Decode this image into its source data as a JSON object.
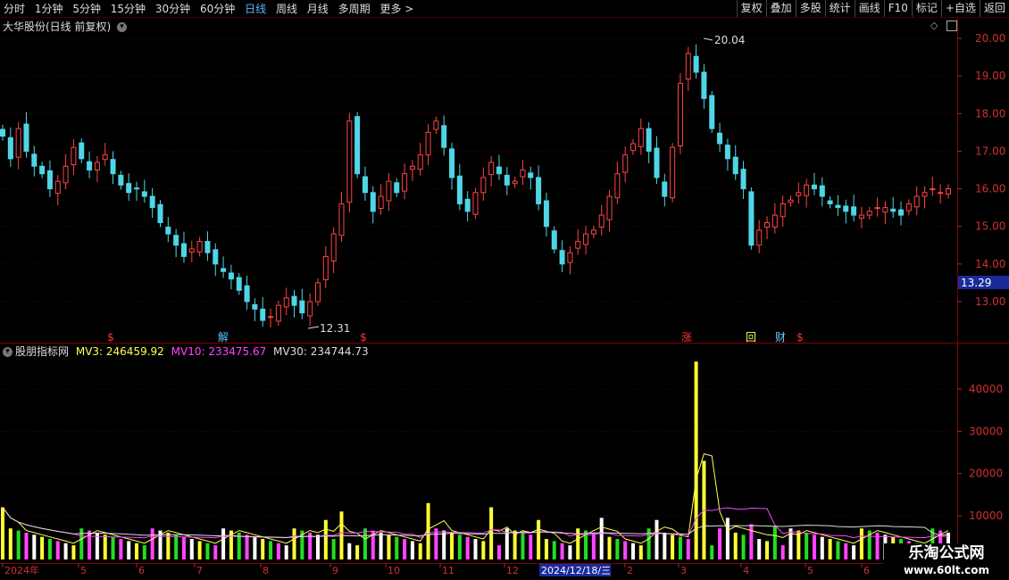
{
  "toolbar": {
    "periods": [
      "分时",
      "1分钟",
      "5分钟",
      "15分钟",
      "30分钟",
      "60分钟",
      "日线",
      "周线",
      "月线",
      "多周期",
      "更多 >"
    ],
    "active_period": "日线",
    "buttons": [
      "复权",
      "叠加",
      "多股",
      "统计",
      "画线",
      "F10",
      "标记",
      "+自选",
      "返回"
    ]
  },
  "price_panel": {
    "title": "大华股份(日线 前复权)",
    "high_label": "20.04",
    "low_label": "12.31",
    "current_price": "13.29",
    "markers": [
      {
        "text": "$",
        "color": "#ff3333"
      },
      {
        "text": "解",
        "color": "#55ccff"
      },
      {
        "text": "$",
        "color": "#ff3333"
      },
      {
        "text": "涨",
        "color": "#ff3333"
      },
      {
        "text": "回",
        "color": "#ffff66"
      },
      {
        "text": "财",
        "color": "#66ccff"
      },
      {
        "text": "$",
        "color": "#ff3333"
      }
    ]
  },
  "volume_panel": {
    "title": "股朋指标网",
    "mv3_label": "MV3: 246459.92",
    "mv10_label": "MV10: 233475.67",
    "mv30_label": "MV30: 234744.73"
  },
  "chart_data": [
    {
      "type": "candlestick",
      "title": "大华股份(日线 前复权)",
      "ylim": [
        12.0,
        20.5
      ],
      "y_ticks": [
        "20.00",
        "19.00",
        "18.00",
        "17.00",
        "16.00",
        "15.00",
        "14.00",
        "13.00"
      ],
      "close_path": [
        17.4,
        16.8,
        17.6,
        17.0,
        16.6,
        16.4,
        16.0,
        16.2,
        16.6,
        17.1,
        16.8,
        16.5,
        16.7,
        16.9,
        16.4,
        16.1,
        15.9,
        16.0,
        15.8,
        15.5,
        15.1,
        14.8,
        14.5,
        14.2,
        14.4,
        14.6,
        14.3,
        14.0,
        13.8,
        13.6,
        13.3,
        13.0,
        12.8,
        12.5,
        12.6,
        12.9,
        13.1,
        12.9,
        12.7,
        13.0,
        13.5,
        14.2,
        14.8,
        15.6,
        17.8,
        16.4,
        15.9,
        15.4,
        15.8,
        16.2,
        15.9,
        16.4,
        16.6,
        16.9,
        17.5,
        17.8,
        17.1,
        16.3,
        15.6,
        15.4,
        15.9,
        16.3,
        16.7,
        16.4,
        16.1,
        16.2,
        16.5,
        16.3,
        15.6,
        15.0,
        14.4,
        14.0,
        14.3,
        14.6,
        14.8,
        14.9,
        15.3,
        15.8,
        16.4,
        16.9,
        17.2,
        17.6,
        17.0,
        16.3,
        15.8,
        17.1,
        18.8,
        19.6,
        19.1,
        18.4,
        17.6,
        17.2,
        16.8,
        16.4,
        16.0,
        14.5,
        14.9,
        15.1,
        15.3,
        15.6,
        15.7,
        15.9,
        16.1,
        16.0,
        15.8,
        15.6,
        15.5,
        15.4,
        15.3,
        15.3,
        15.4,
        15.5,
        15.5,
        15.4,
        15.3,
        15.6,
        15.8,
        15.9,
        16.0,
        15.9,
        16.0
      ],
      "annotations": [
        "20.04",
        "12.31",
        "13.29"
      ]
    },
    {
      "type": "bar",
      "title": "股朋指标网",
      "ylim": [
        0,
        48000
      ],
      "y_ticks": [
        "40000",
        "30000",
        "20000",
        "10000"
      ],
      "x_labels": [
        "2024年",
        "5",
        "6",
        "7",
        "8",
        "9",
        "10",
        "11",
        "12",
        "2024/12/18/三",
        "2",
        "3",
        "4",
        "5",
        "6"
      ],
      "series": [
        {
          "name": "MV3",
          "value": 246459.92,
          "color": "#ffff55"
        },
        {
          "name": "MV10",
          "value": 233475.67,
          "color": "#ff44ff"
        },
        {
          "name": "MV30",
          "value": 234744.73,
          "color": "#dddddd"
        }
      ]
    }
  ],
  "watermark": {
    "line1": "乐淘公式网",
    "line2": "www.60lt.com"
  },
  "colors": {
    "up": "#ff4444",
    "down": "#4fd6e6",
    "axis": "#c02020",
    "grid": "#550000"
  }
}
